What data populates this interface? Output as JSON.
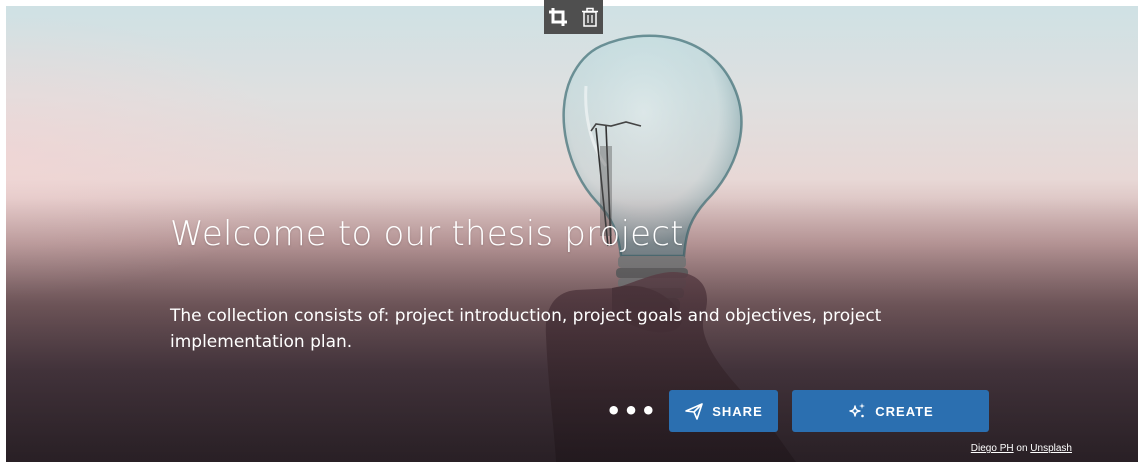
{
  "hero": {
    "title": "Welcome to our thesis project",
    "description": "The collection consists of: project introduction, project goals and objectives, project implementation plan.",
    "background_image": "light-bulb-in-hand-photo"
  },
  "media_toolbar": {
    "crop_icon": "crop-icon",
    "delete_icon": "trash-icon"
  },
  "actions": {
    "more_label": "•••",
    "share_label": "SHARE",
    "share_icon": "paper-plane-icon",
    "create_label": "CREATE",
    "create_icon": "sparkle-icon"
  },
  "credit": {
    "author": "Diego PH",
    "connector": "on",
    "source": "Unsplash"
  },
  "colors": {
    "button_blue": "#2b6fb0",
    "toolbar_gray": "#4f4f4f"
  }
}
